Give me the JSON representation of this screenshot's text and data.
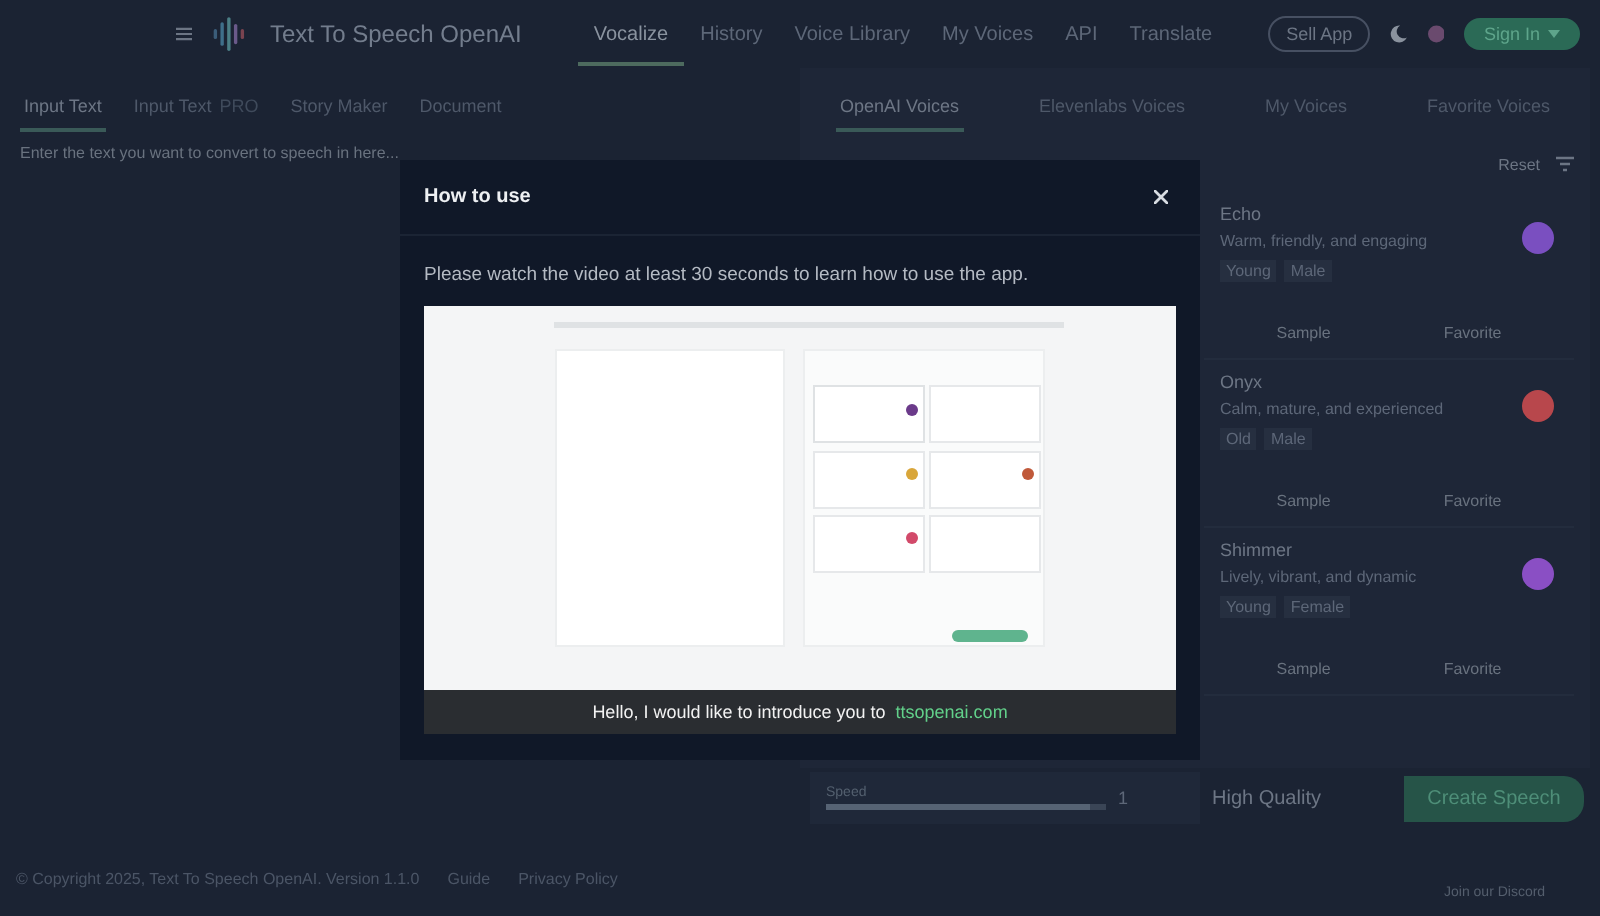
{
  "header": {
    "title": "Text To Speech OpenAI",
    "nav": [
      {
        "label": "Vocalize",
        "selected": true
      },
      {
        "label": "History",
        "selected": false
      },
      {
        "label": "Voice Library",
        "selected": false
      },
      {
        "label": "My Voices",
        "selected": false
      },
      {
        "label": "API",
        "selected": false
      },
      {
        "label": "Translate",
        "selected": false
      }
    ],
    "sell_button": "Sell App",
    "sign_in_button": "Sign In"
  },
  "input_tabs": [
    {
      "label": "Input Text",
      "selected": true
    },
    {
      "label": "Input Text",
      "badge": "PRO",
      "selected": false
    },
    {
      "label": "Story Maker",
      "selected": false
    },
    {
      "label": "Document",
      "selected": false
    }
  ],
  "input": {
    "placeholder": "Enter the text you want to convert to speech in here..."
  },
  "voice_tabs": [
    {
      "label": "OpenAI Voices",
      "selected": true
    },
    {
      "label": "Elevenlabs Voices",
      "selected": false
    },
    {
      "label": "My Voices",
      "selected": false
    },
    {
      "label": "Favorite Voices",
      "selected": false
    }
  ],
  "reset_button": "Reset",
  "voices": [
    {
      "name": "Echo",
      "description": "Warm, friendly, and engaging",
      "tags": [
        "Young",
        "Male"
      ],
      "color": "#7a4fc0",
      "sample": "Sample",
      "favorite": "Favorite"
    },
    {
      "name": "Onyx",
      "description": "Calm, mature, and experienced",
      "tags": [
        "Old",
        "Male"
      ],
      "color": "#b8474c",
      "sample": "Sample",
      "favorite": "Favorite"
    },
    {
      "name": "Shimmer",
      "description": "Lively, vibrant, and dynamic",
      "tags": [
        "Young",
        "Female"
      ],
      "color": "#8a4fc4",
      "sample": "Sample",
      "favorite": "Favorite"
    }
  ],
  "speed": {
    "label": "Speed",
    "level": 0.94,
    "reading": "1"
  },
  "quality": {
    "value": "High Quality"
  },
  "create_button": "Create Speech",
  "discord_link": "Join our Discord",
  "footer": {
    "copyright": "© Copyright 2025, Text To Speech OpenAI. Version 1.1.0",
    "links": [
      "Guide",
      "Privacy Policy"
    ]
  },
  "modal": {
    "title": "How to use",
    "message": "Please watch the video at least 30 seconds to learn how to use the app.",
    "video": {
      "kind": "picture",
      "caption": "Hello, I would like to introduce you to ",
      "caption_link": "ttsopenai.com"
    }
  }
}
